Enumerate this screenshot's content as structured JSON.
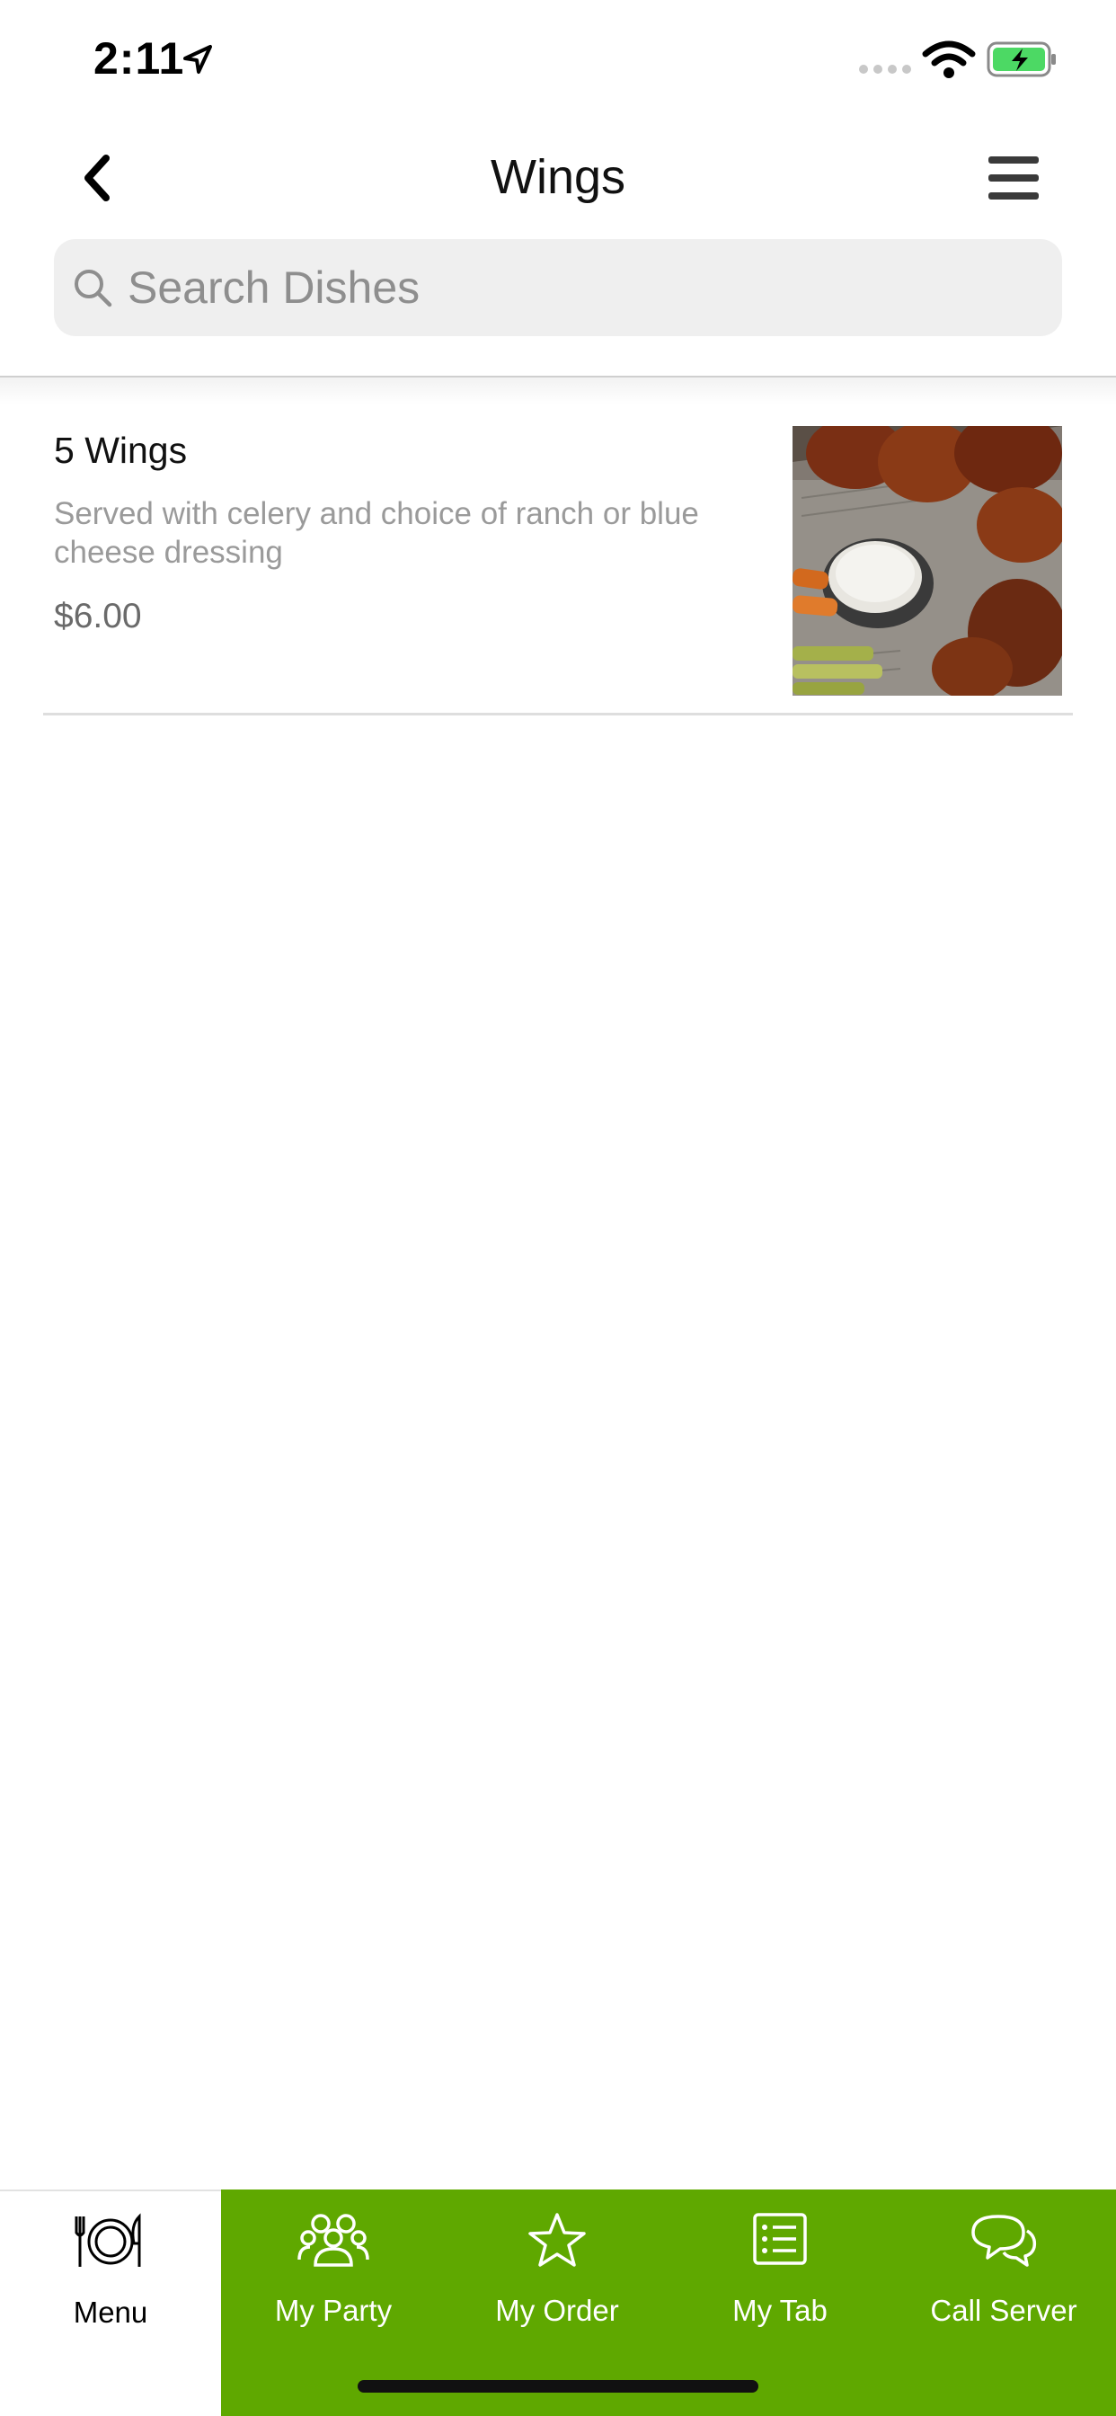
{
  "status_bar": {
    "time": "2:11"
  },
  "header": {
    "title": "Wings"
  },
  "search": {
    "placeholder": "Search Dishes"
  },
  "dishes": [
    {
      "name": "5 Wings",
      "description": "Served with celery and choice of ranch or blue cheese dressing",
      "price": "$6.00"
    }
  ],
  "tab_bar": {
    "accent_color": "#5fa800",
    "tabs": [
      {
        "label": "Menu",
        "icon": "menu-plate-icon",
        "active": true
      },
      {
        "label": "My Party",
        "icon": "party-people-icon",
        "active": false
      },
      {
        "label": "My Order",
        "icon": "star-icon",
        "active": false
      },
      {
        "label": "My Tab",
        "icon": "tab-list-icon",
        "active": false
      },
      {
        "label": "Call Server",
        "icon": "chat-bubbles-icon",
        "active": false
      }
    ]
  }
}
